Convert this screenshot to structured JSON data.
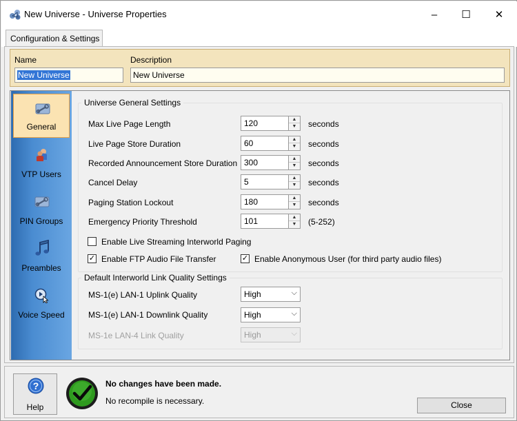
{
  "window": {
    "title": "New Universe - Universe Properties",
    "minimize": "–",
    "maximize": "☐",
    "close": "✕"
  },
  "tabs": [
    {
      "label": "Configuration & Settings"
    }
  ],
  "header": {
    "name_label": "Name",
    "name_value": "New Universe",
    "description_label": "Description",
    "description_value": "New Universe"
  },
  "sidebar": {
    "items": [
      {
        "label": "General",
        "icon": "wrench-icon",
        "selected": true
      },
      {
        "label": "VTP Users",
        "icon": "users-icon",
        "selected": false
      },
      {
        "label": "PIN Groups",
        "icon": "wrench-icon",
        "selected": false
      },
      {
        "label": "Preambles",
        "icon": "music-note-icon",
        "selected": false
      },
      {
        "label": "Voice Speed",
        "icon": "speed-cursor-icon",
        "selected": false
      }
    ]
  },
  "general": {
    "group_title": "Universe General Settings",
    "fields": [
      {
        "label": "Max Live Page Length",
        "value": "120",
        "unit": "seconds"
      },
      {
        "label": "Live Page Store Duration",
        "value": "60",
        "unit": "seconds"
      },
      {
        "label": "Recorded Announcement Store Duration",
        "value": "300",
        "unit": "seconds"
      },
      {
        "label": "Cancel Delay",
        "value": "5",
        "unit": "seconds"
      },
      {
        "label": "Paging Station Lockout",
        "value": "180",
        "unit": "seconds"
      },
      {
        "label": "Emergency Priority Threshold",
        "value": "101",
        "unit": "(5-252)"
      }
    ],
    "checkboxes": [
      {
        "label": "Enable Live Streaming Interworld Paging",
        "checked": false
      },
      {
        "label": "Enable FTP Audio File Transfer",
        "checked": true
      },
      {
        "label": "Enable Anonymous User (for third party audio files)",
        "checked": true
      }
    ]
  },
  "link_quality": {
    "group_title": "Default Interworld Link Quality Settings",
    "rows": [
      {
        "label": "MS-1(e) LAN-1 Uplink Quality",
        "value": "High",
        "enabled": true
      },
      {
        "label": "MS-1(e) LAN-1 Downlink Quality",
        "value": "High",
        "enabled": true
      },
      {
        "label": "MS-1e LAN-4 Link Quality",
        "value": "High",
        "enabled": false
      }
    ]
  },
  "footer": {
    "help_label": "Help",
    "status_title": "No changes have been made.",
    "status_detail": "No recompile is necessary.",
    "close_label": "Close"
  },
  "colors": {
    "accent_selection": "#3275d6",
    "sidebar_blue": "#4a8cd1",
    "header_tan": "#f3e4bd",
    "status_ok_green": "#2f9a1f"
  }
}
